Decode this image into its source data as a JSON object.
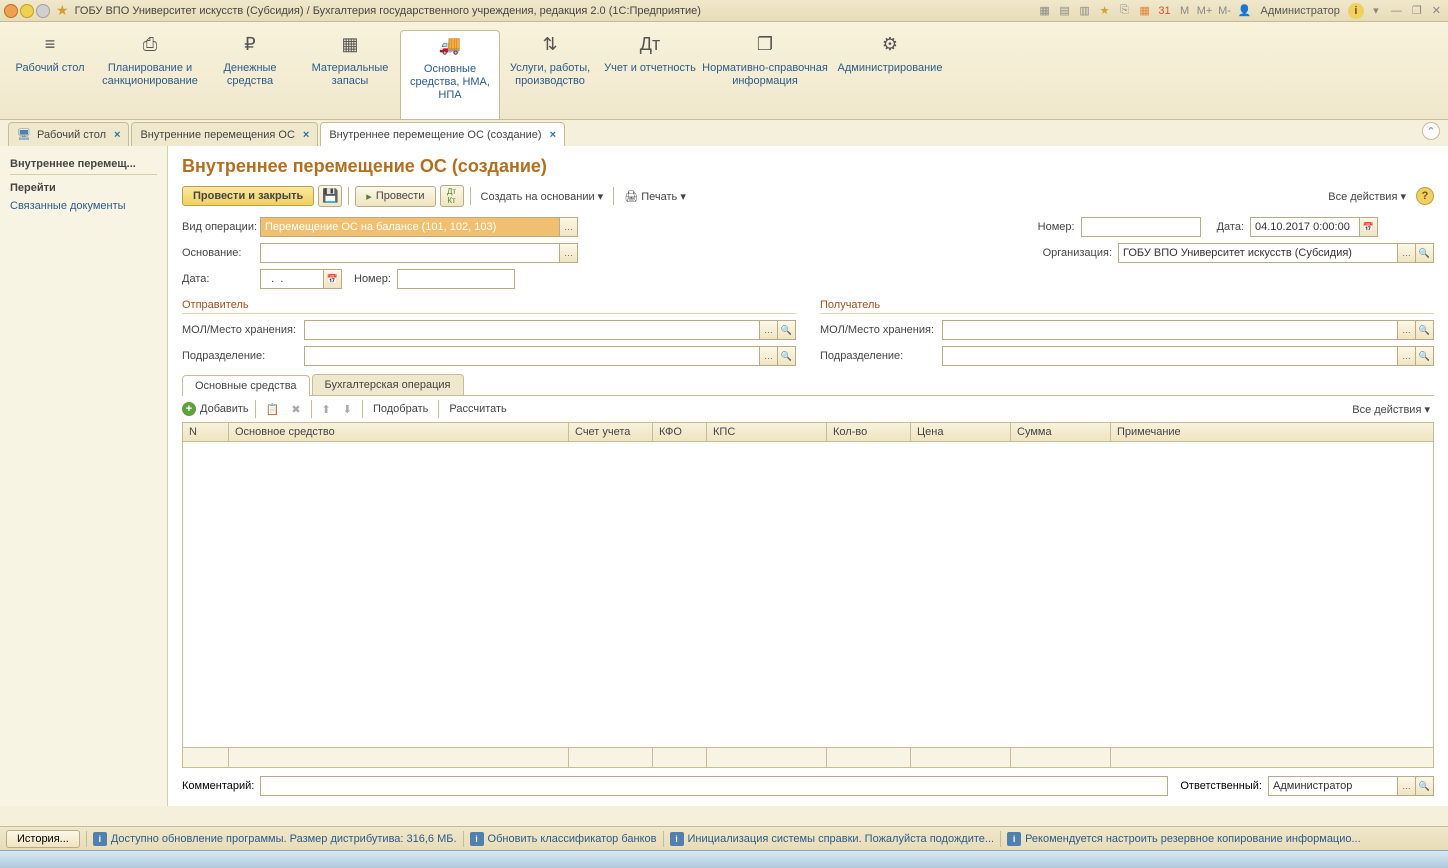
{
  "titlebar": {
    "title": "ГОБУ ВПО Университет искусств (Субсидия) / Бухгалтерия государственного учреждения, редакция 2.0  (1С:Предприятие)",
    "user": "Администратор",
    "m": "M",
    "mplus": "M+",
    "mminus": "M-"
  },
  "mainnav": [
    {
      "label": "Рабочий стол",
      "icon": "≡"
    },
    {
      "label": "Планирование и санкционирование",
      "icon": "⎙"
    },
    {
      "label": "Денежные средства",
      "icon": "₽"
    },
    {
      "label": "Материальные запасы",
      "icon": "▦"
    },
    {
      "label": "Основные средства, НМА, НПА",
      "icon": "🚚"
    },
    {
      "label": "Услуги, работы, производство",
      "icon": "⇅"
    },
    {
      "label": "Учет и отчетность",
      "icon": "Дт"
    },
    {
      "label": "Нормативно-справочная информация",
      "icon": "❐"
    },
    {
      "label": "Администрирование",
      "icon": "⚙"
    }
  ],
  "tabs": [
    {
      "label": "Рабочий стол"
    },
    {
      "label": "Внутренние перемещения ОС"
    },
    {
      "label": "Внутреннее перемещение ОС (создание)"
    }
  ],
  "sidebar": {
    "title": "Внутреннее перемещ...",
    "links": [
      "Перейти",
      "Связанные документы"
    ]
  },
  "page": {
    "title": "Внутреннее перемещение ОС (создание)",
    "toolbar": {
      "post_close": "Провести и закрыть",
      "post": "Провести",
      "create_based": "Создать на основании",
      "print": "Печать",
      "all_actions": "Все действия"
    },
    "form": {
      "operation_type_label": "Вид операции:",
      "operation_type_value": "Перемещение ОС на балансе (101, 102, 103)",
      "basis_label": "Основание:",
      "date_label": "Дата:",
      "date_value": "  .  .    ",
      "number_label": "Номер:",
      "doc_number_label": "Номер:",
      "doc_date_label": "Дата:",
      "doc_date_value": "04.10.2017 0:00:00",
      "org_label": "Организация:",
      "org_value": "ГОБУ ВПО Университет искусств (Субсидия)",
      "sender_title": "Отправитель",
      "receiver_title": "Получатель",
      "mol_label": "МОЛ/Место хранения:",
      "dept_label": "Подразделение:"
    },
    "subtabs": [
      "Основные средства",
      "Бухгалтерская операция"
    ],
    "tbltoolbar": {
      "add": "Добавить",
      "select": "Подобрать",
      "calc": "Рассчитать",
      "all_actions": "Все действия"
    },
    "columns": [
      "N",
      "Основное средство",
      "Счет учета",
      "КФО",
      "КПС",
      "Кол-во",
      "Цена",
      "Сумма",
      "Примечание"
    ],
    "comment_label": "Комментарий:",
    "responsible_label": "Ответственный:",
    "responsible_value": "Администратор"
  },
  "statusbar": {
    "history": "История...",
    "items": [
      "Доступно обновление программы. Размер дистрибутива: 316,6 МБ.",
      "Обновить классификатор банков",
      "Инициализация системы справки. Пожалуйста подождите...",
      "Рекомендуется настроить резервное копирование информацио..."
    ]
  }
}
